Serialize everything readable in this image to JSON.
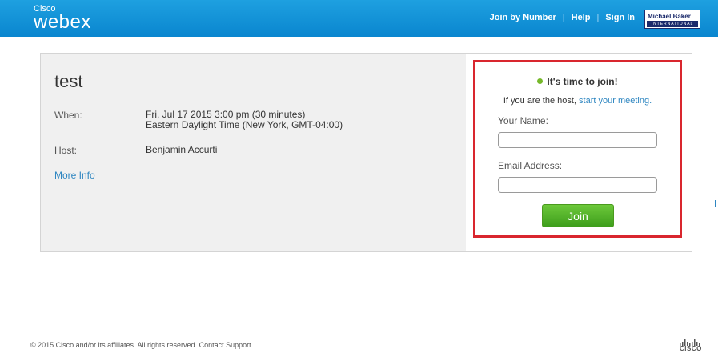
{
  "header": {
    "brand_top": "Cisco",
    "brand_main": "webex",
    "nav": {
      "join_by_number": "Join by Number",
      "help": "Help",
      "sign_in": "Sign In"
    },
    "partner_logo": {
      "name": "Michael Baker",
      "subtitle": "INTERNATIONAL"
    }
  },
  "meeting": {
    "title": "test",
    "when_label": "When:",
    "when_line1": "Fri, Jul 17 2015 3:00 pm (30 minutes)",
    "when_line2": "Eastern Daylight Time (New York, GMT-04:00)",
    "host_label": "Host:",
    "host_value": "Benjamin Accurti",
    "more_info": "More Info"
  },
  "join": {
    "status": "It's time to join!",
    "host_text": "If you are the host,",
    "host_link": "start your meeting.",
    "name_label": "Your Name:",
    "name_value": "",
    "email_label": "Email Address:",
    "email_value": "",
    "button": "Join"
  },
  "footer": {
    "copyright": "© 2015 Cisco and/or its affiliates. All rights reserved.",
    "contact": "Contact Support",
    "cisco_logo": "CISCO"
  },
  "colors": {
    "header_blue": "#0a86cf",
    "link_blue": "#2e86c1",
    "join_green": "#3e9e1c",
    "highlight_red": "#d9262e",
    "status_dot": "#76b82a"
  }
}
